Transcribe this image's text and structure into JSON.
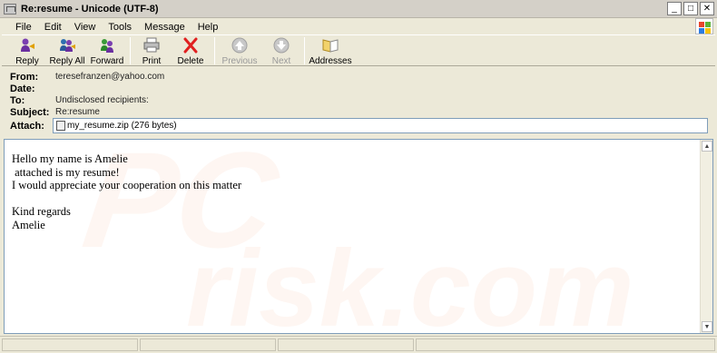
{
  "window": {
    "title": "Re:resume - Unicode (UTF-8)",
    "controls": [
      "minimize",
      "maximize",
      "close"
    ]
  },
  "menu": [
    "File",
    "Edit",
    "View",
    "Tools",
    "Message",
    "Help"
  ],
  "toolbar": {
    "buttons": [
      {
        "label": "Reply",
        "icon": "reply-icon",
        "enabled": true
      },
      {
        "label": "Reply All",
        "icon": "reply-all-icon",
        "enabled": true
      },
      {
        "label": "Forward",
        "icon": "forward-icon",
        "enabled": true
      },
      {
        "label": "Print",
        "icon": "print-icon",
        "enabled": true
      },
      {
        "label": "Delete",
        "icon": "delete-icon",
        "enabled": true
      },
      {
        "label": "Previous",
        "icon": "previous-icon",
        "enabled": false
      },
      {
        "label": "Next",
        "icon": "next-icon",
        "enabled": false
      },
      {
        "label": "Addresses",
        "icon": "addresses-icon",
        "enabled": true
      }
    ]
  },
  "header": {
    "from_label": "From:",
    "from_value": "teresefranzen@yahoo.com",
    "date_label": "Date:",
    "date_value": "",
    "to_label": "To:",
    "to_value": "Undisclosed recipients:",
    "subject_label": "Subject:",
    "subject_value": "Re:resume",
    "attach_label": "Attach:",
    "attach_value": "my_resume.zip (276 bytes)"
  },
  "body": {
    "text": "Hello my name is Amelie\n attached is my resume!\nI would appreciate your cooperation on this matter\n\nKind regards\nAmelie"
  },
  "watermark": "risk.com",
  "colors": {
    "chrome": "#ece9d8",
    "delete_red": "#e02020",
    "field_border": "#7f9db9"
  }
}
